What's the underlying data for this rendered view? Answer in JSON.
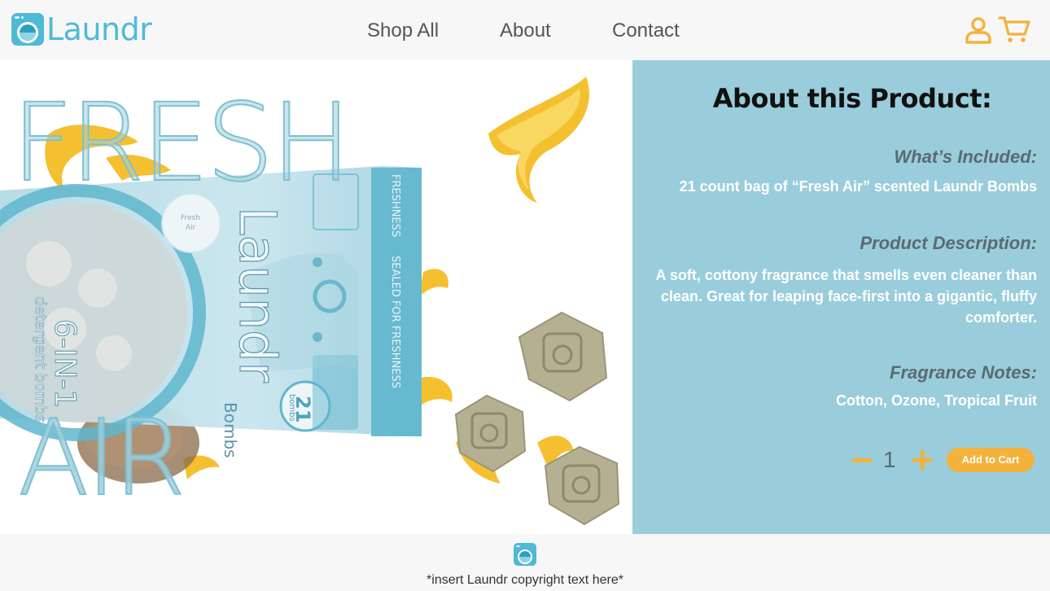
{
  "header": {
    "brand": "Laundr",
    "nav": [
      {
        "label": "Shop All"
      },
      {
        "label": "About"
      },
      {
        "label": "Contact"
      }
    ],
    "icons": [
      "washer-logo-icon",
      "user-icon",
      "cart-icon"
    ]
  },
  "hero": {
    "word_top": "FRESH",
    "word_bottom": "AIR",
    "package": {
      "brand": "Laundr",
      "sub": "Bombs",
      "type": "6-IN-1",
      "desc": "detergent bombs",
      "badge_count": "21",
      "badge_unit": "bombs",
      "scent": "Fresh Air",
      "side_text": "SEALED FOR FRESHNESS"
    }
  },
  "panel": {
    "title": "About this Product:",
    "included_heading": "What’s Included:",
    "included_text": "21 count bag of “Fresh Air” scented Laundr Bombs",
    "description_heading": "Product Description:",
    "description_text": "A soft, cottony fragrance that smells even cleaner than clean. Great for leaping face-first into a gigantic, fluffy comforter.",
    "notes_heading": "Fragrance Notes:",
    "notes_text": "Cotton, Ozone, Tropical Fruit",
    "quantity": "1",
    "add_to_cart": "Add to Cart"
  },
  "footer": {
    "copyright": "*insert Laundr copyright text here*"
  },
  "colors": {
    "brand": "#4fbad6",
    "panel": "#9acddb",
    "accent": "#f2b23b",
    "heading": "#5a6a72"
  }
}
